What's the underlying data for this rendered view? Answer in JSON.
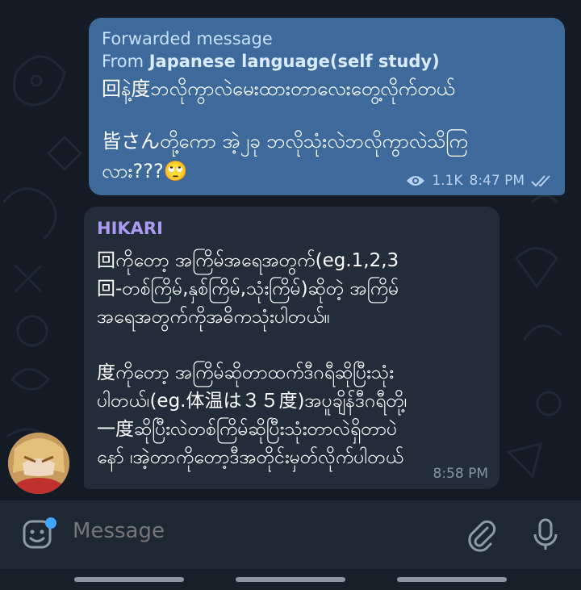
{
  "forwarded": {
    "label": "Forwarded message",
    "from_prefix": "From ",
    "from_name": "Japanese language(self study)",
    "line1": "回နဲ့度ဘလိုကွာလဲမေးထားတာလေးတွေ့လိုက်တယ်",
    "line2": "皆さんတို့ကော အဲ့၂ခု ဘလိုသုံးလဲဘလိုကွာလဲသိကြ",
    "line3": "လား???🙄",
    "views": "1.1K",
    "time": "8:47 PM",
    "status_icon": "double-check-icon"
  },
  "reply": {
    "sender": "HIKARI",
    "line1": "回ကိုတော့ အကြိမ်အရေအတွက်(eg.1,2,3",
    "line2": "回-တစ်ကြိမ်,နှစ်ကြိမ်,သုံးကြိမ်)ဆိုတဲ့ အကြိမ်",
    "line3": "အရေအတွက်ကိုအဓိကသုံးပါတယ်။",
    "line4": "度ကိုတော့ အကြိမ်ဆိုတာထက်ဒီဂရီဆိုပြီးသုံး",
    "line5": "ပါတယ်၊(eg.体温は３５度)အပူချိန်ဒီဂရီတို့၊",
    "line6": "一度ဆိုပြီးလဲတစ်ကြိမ်ဆိုပြီးသုံးတာလဲရှိတာပဲ",
    "line7": "နော် ၊အဲ့တာကိုတော့ဒီအတိုင်းမှတ်လိုက်ပါတယ်",
    "time": "8:58 PM"
  },
  "composer": {
    "placeholder": "Message",
    "icons": [
      "sticker-icon",
      "attach-icon",
      "mic-icon"
    ]
  },
  "colors": {
    "outgoing_bubble": "#3e6a9b",
    "incoming_bubble": "#222d39",
    "sender_name": "#a99bf2",
    "badge_dot": "#3fa7ff"
  }
}
